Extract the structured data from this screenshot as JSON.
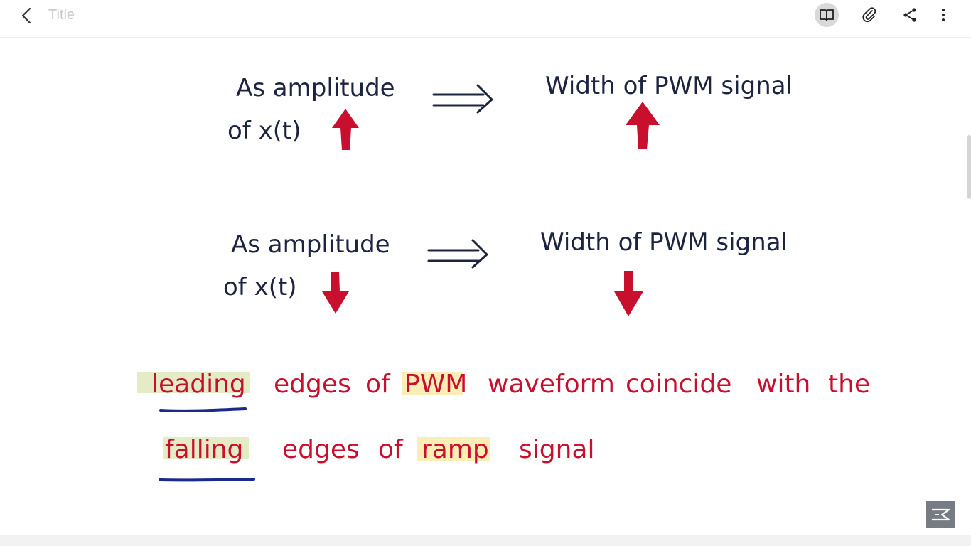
{
  "header": {
    "title_placeholder": "Title",
    "icons": [
      "back-icon",
      "book-icon",
      "paperclip-icon",
      "share-icon",
      "more-vert-icon"
    ]
  },
  "note": {
    "block1": {
      "left_line1": "As  amplitude",
      "left_line2": "of  x(t)",
      "right_line1": "Width  of  PWM  signal",
      "direction": "up"
    },
    "block2": {
      "left_line1": "As  amplitude",
      "left_line2": "of  x(t)",
      "right_line1": "Width  of  PWM  signal",
      "direction": "down"
    },
    "sentence": {
      "w_leading": "leading",
      "w_edges1": "edges",
      "w_of1": "of",
      "w_pwm": "PWM",
      "w_waveform": "waveform",
      "w_coincide": "coincide",
      "w_with": "with",
      "w_the": "the",
      "w_falling": "falling",
      "w_edges2": "edges",
      "w_of2": "of",
      "w_ramp": "ramp",
      "w_signal": "signal"
    }
  },
  "colors": {
    "ink": "#1c2440",
    "red": "#c8102e",
    "underline": "#1a2a8a",
    "highlight_green": "#e3ecc4",
    "highlight_yellow": "#faedb6"
  }
}
